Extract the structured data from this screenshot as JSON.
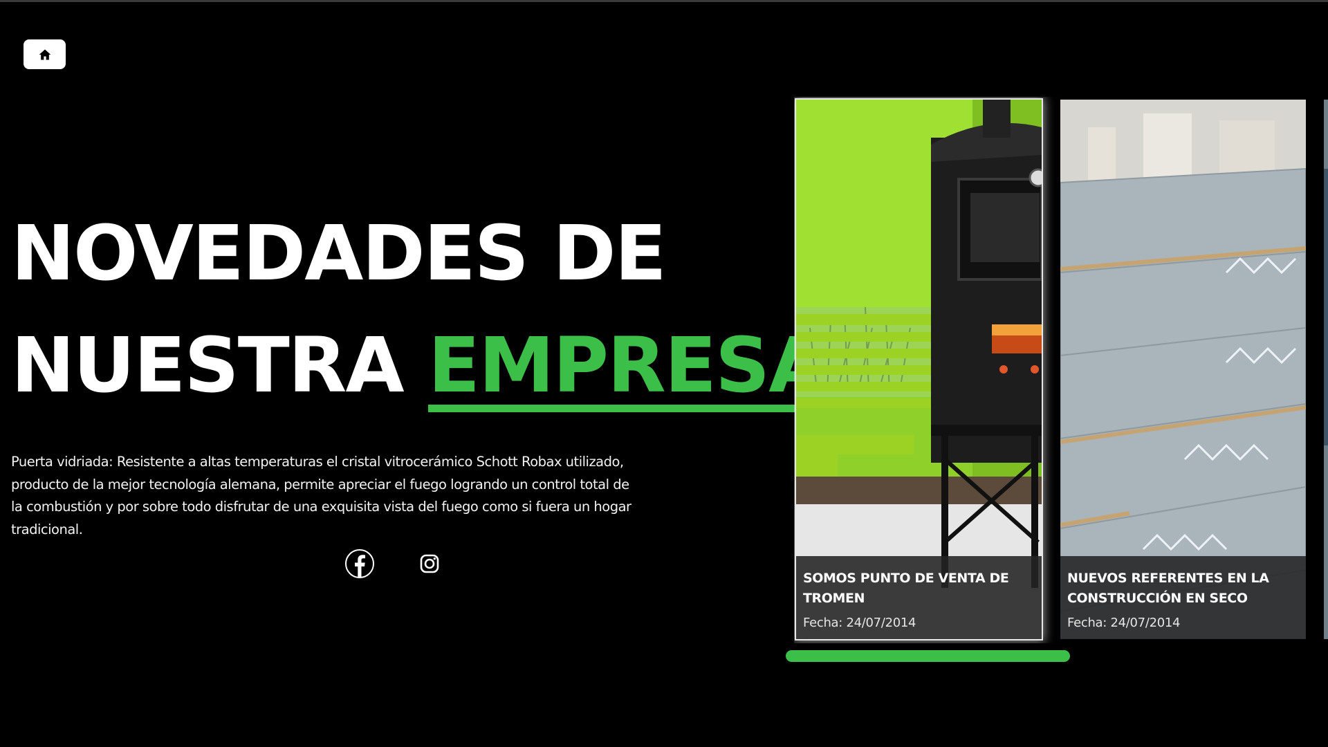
{
  "nav": {
    "home_icon": "home-icon"
  },
  "hero": {
    "title_line1": "NOVEDADES DE",
    "title_line2_prefix": "NUESTRA ",
    "title_accent": "EMPRESA",
    "description": "Puerta vidriada: Resistente a altas temperaturas el cristal vitrocerámico Schott Robax utilizado, producto de la mejor tecnología alemana, permite apreciar el fuego logrando un control total de la combustión y por sobre todo disfrutar de una exquisita vista del fuego como si fuera un hogar tradicional."
  },
  "social": {
    "facebook_icon": "facebook-icon",
    "instagram_icon": "instagram-icon"
  },
  "news": [
    {
      "title": "SOMOS PUNTO DE VENTA DE TROMEN",
      "date": "Fecha: 24/07/2014"
    },
    {
      "title": "NUEVOS REFERENTES EN LA CONSTRUCCIÓN EN SECO",
      "date": "Fecha: 24/07/2014"
    }
  ],
  "colors": {
    "accent": "#3cbf49",
    "background": "#000000",
    "caption_bg": "#232323"
  }
}
